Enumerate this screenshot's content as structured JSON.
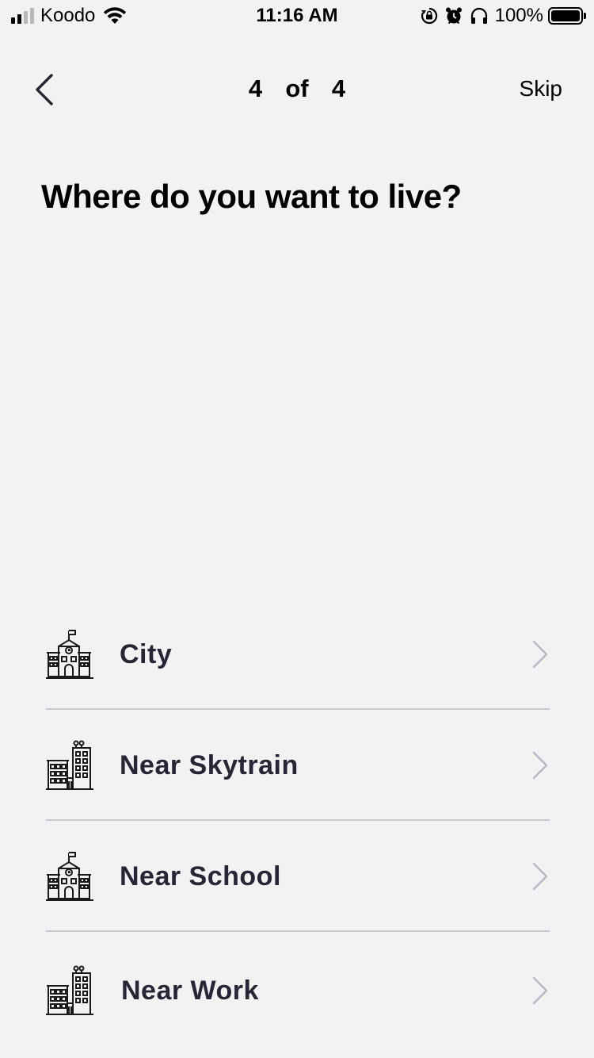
{
  "status_bar": {
    "carrier": "Koodo",
    "time": "11:16 AM",
    "battery_percent": "100%",
    "battery_level": 1.0,
    "signal_bars": 2,
    "icons": [
      "wifi-icon",
      "orientation-lock-icon",
      "alarm-icon",
      "headphones-icon",
      "battery-icon"
    ]
  },
  "header": {
    "back_icon": "chevron-left-icon",
    "step": "4  of  4",
    "skip_label": "Skip"
  },
  "question": {
    "title": "Where do you want to live?"
  },
  "options": [
    {
      "label": "City",
      "icon": "school-building-icon"
    },
    {
      "label": "Near Skytrain",
      "icon": "city-buildings-icon"
    },
    {
      "label": "Near School",
      "icon": "school-building-icon"
    },
    {
      "label": "Near Work",
      "icon": "city-buildings-icon"
    }
  ],
  "colors": {
    "background": "#f2f2f2",
    "option_text": "#262637",
    "divider": "#c8c7d4",
    "chevron": "#b9b8c8"
  }
}
